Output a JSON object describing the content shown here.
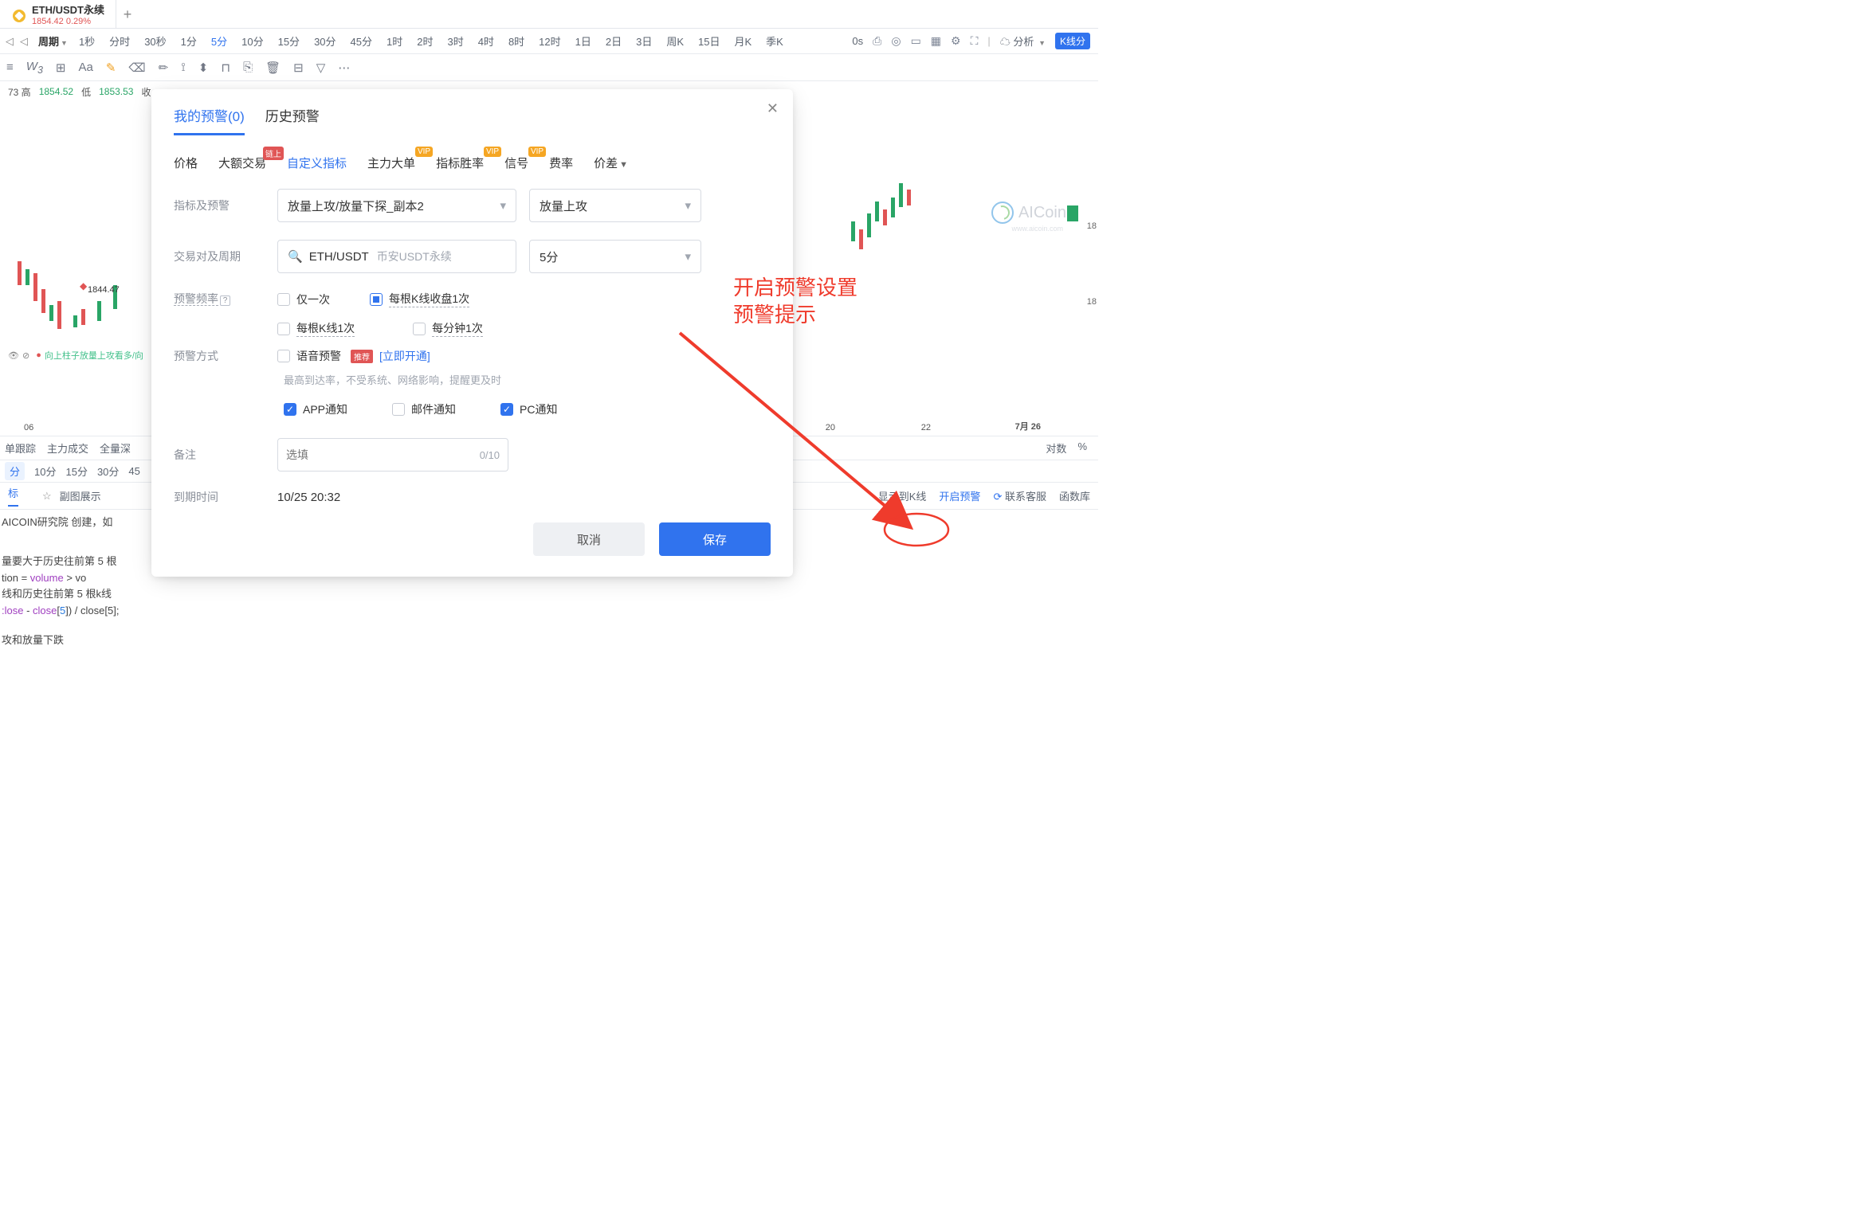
{
  "tab": {
    "symbol": "ETH/USDT永续",
    "price": "1854.42",
    "change": "0.29%"
  },
  "period": {
    "label": "周期",
    "items": [
      "1秒",
      "分时",
      "30秒",
      "1分",
      "5分",
      "10分",
      "15分",
      "30分",
      "45分",
      "1时",
      "2时",
      "3时",
      "4时",
      "8时",
      "12时",
      "1日",
      "2日",
      "3日",
      "周K",
      "15日",
      "月K",
      "季K"
    ],
    "active": "5分",
    "right": {
      "speed": "0s",
      "analysis": "分析",
      "kline": "K线分"
    }
  },
  "ohlc": {
    "label1": "73 高",
    "high": "1854.52",
    "label2": "低",
    "low": "1853.53",
    "label3": "收"
  },
  "chart": {
    "priceLabel": "1844.47",
    "x1": "06",
    "x2": "20",
    "x3": "22",
    "x4": "7月 26",
    "ind": "向上柱子放量上攻看多/向",
    "rn1": "18",
    "rn2": "18"
  },
  "bottomTabs": {
    "t1": "单跟踪",
    "t2": "主力成交",
    "t3": "全量深",
    "r1": "对数",
    "r2": "%"
  },
  "intervals": {
    "active": "分",
    "items": [
      "10分",
      "15分",
      "30分",
      "45"
    ]
  },
  "scriptTabs": {
    "active": "标",
    "star": "副图展示",
    "right": {
      "showK": "显示到K线",
      "alert": "开启预警",
      "contact": "联系客服",
      "lib": "函数库"
    }
  },
  "code": {
    "l1a": "AICOIN研究院 创建，如",
    "l2a": "量要大于历史往前第 5 根",
    "l3a": "tion = ",
    "l3b": "volume",
    "l3c": " > vo",
    "l4a": "线和历史往前第 5 根k线",
    "l5a": ":lose",
    "l5b": " - ",
    "l5c": "close",
    "l5d": "[",
    "l5e": "5",
    "l5f": "]) / close[5];",
    "l6": "攻和放量下跌"
  },
  "aicoin": {
    "name": "AICoin",
    "url": "www.aicoin.com"
  },
  "modal": {
    "tabs": {
      "mine": "我的预警(0)",
      "history": "历史预警"
    },
    "subtabs": {
      "price": "价格",
      "bigdeal": "大额交易",
      "custom": "自定义指标",
      "main": "主力大单",
      "winrate": "指标胜率",
      "signal": "信号",
      "fee": "费率",
      "spread": "价差",
      "badges": {
        "chain": "链上",
        "vip": "VIP"
      }
    },
    "rows": {
      "indicator": {
        "label": "指标及预警",
        "sel1": "放量上攻/放量下探_副本2",
        "sel2": "放量上攻"
      },
      "pair": {
        "label": "交易对及周期",
        "value": "ETH/USDT",
        "suffix": "币安USDT永续",
        "period": "5分"
      },
      "freq": {
        "label": "预警频率",
        "once": "仅一次",
        "perClose": "每根K线收盘1次",
        "perK": "每根K线1次",
        "perMin": "每分钟1次"
      },
      "method": {
        "label": "预警方式",
        "voice": "语音预警",
        "recommend": "推荐",
        "openNow": "[立即开通]",
        "sub": "最高到达率，不受系统、网络影响，提醒更及时",
        "app": "APP通知",
        "mail": "邮件通知",
        "pc": "PC通知"
      },
      "remark": {
        "label": "备注",
        "placeholder": "选填",
        "count": "0/10"
      },
      "expire": {
        "label": "到期时间",
        "value": "10/25 20:32"
      }
    },
    "footer": {
      "cancel": "取消",
      "save": "保存"
    }
  },
  "annotation": {
    "line1": "开启预警设置",
    "line2": "预警提示"
  }
}
